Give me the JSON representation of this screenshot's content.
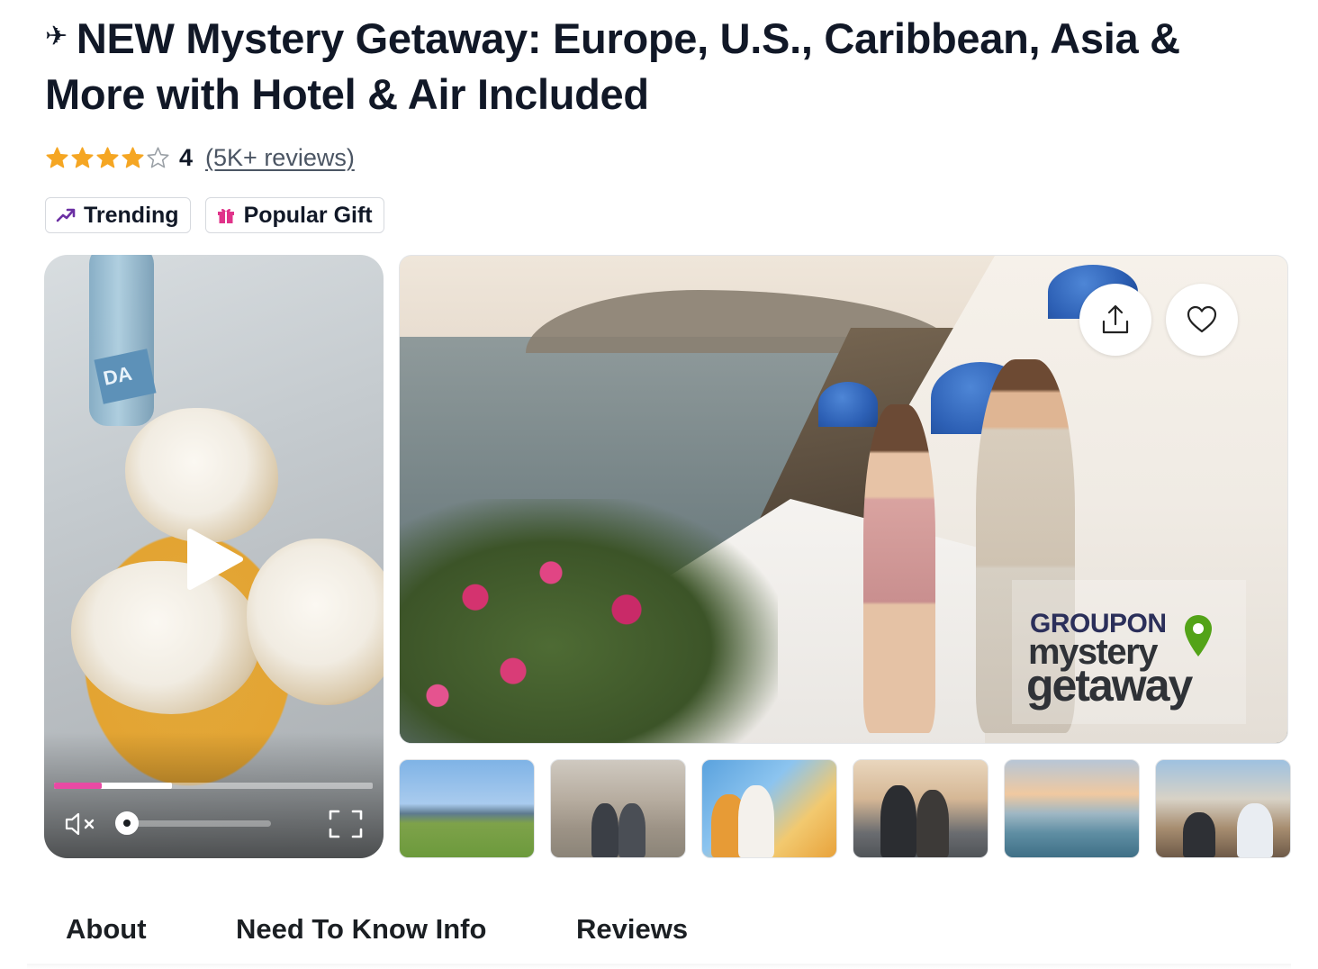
{
  "deal": {
    "title_icon": "airplane-icon",
    "title": "NEW Mystery Getaway: Europe, U.S., Caribbean, Asia & More with Hotel & Air Included"
  },
  "rating": {
    "value": "4",
    "stars_filled": 4,
    "stars_total": 5,
    "reviews_label": "(5K+ reviews)",
    "star_color": "#f5a623"
  },
  "badges": [
    {
      "icon": "trending-icon",
      "label": "Trending",
      "icon_color": "#6b2fa3"
    },
    {
      "icon": "gift-icon",
      "label": "Popular Gift",
      "icon_color": "#e0338a"
    }
  ],
  "video": {
    "bottle_label": "DA",
    "progress_played": 0.15,
    "progress_buffered": 0.37,
    "volume": 0.0,
    "muted": true,
    "progress_color": "#e94aa4"
  },
  "main_image": {
    "alt_icon_share": "share-icon",
    "alt_icon_favorite": "heart-icon",
    "logo": {
      "brand": "GROUPON",
      "line1": "mystery",
      "line2": "getaway",
      "pin_color": "#53a318"
    }
  },
  "thumbnails": [
    {
      "name": "thumbnail-city-park"
    },
    {
      "name": "thumbnail-venice-square"
    },
    {
      "name": "thumbnail-city-selfie"
    },
    {
      "name": "thumbnail-couple-street"
    },
    {
      "name": "thumbnail-beach-skyline"
    },
    {
      "name": "thumbnail-terrace-view"
    }
  ],
  "tabs": [
    {
      "label": "About"
    },
    {
      "label": "Need To Know Info"
    },
    {
      "label": "Reviews"
    }
  ]
}
